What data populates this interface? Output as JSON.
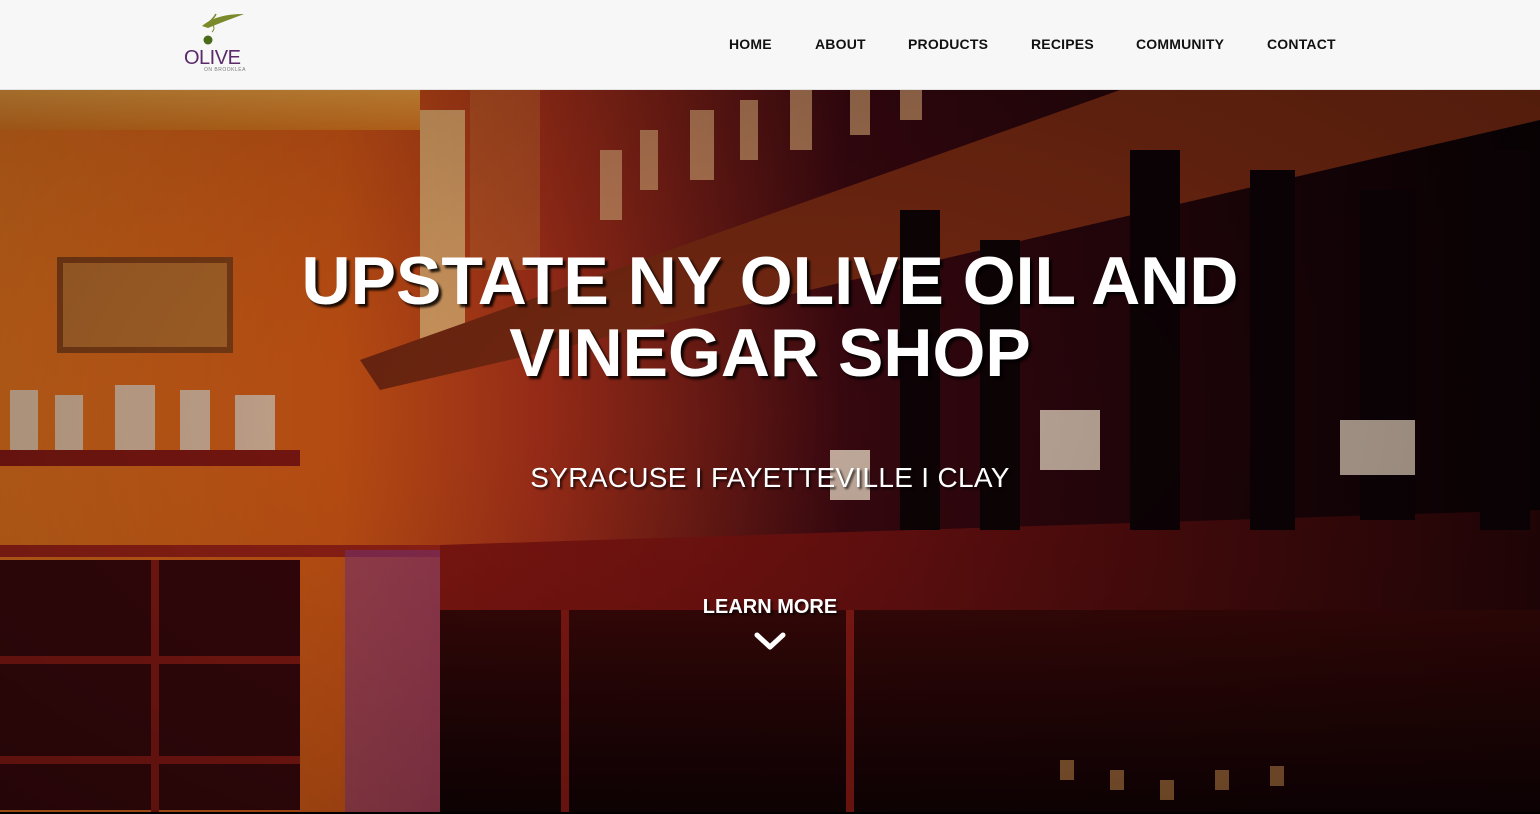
{
  "brand": {
    "logo_word": "OLIVE",
    "logo_sub": "ON BROOKLEA",
    "logo_color": "#5a2a6a",
    "leaf_color": "#7a8a2a"
  },
  "nav": {
    "items": [
      {
        "label": "HOME"
      },
      {
        "label": "ABOUT"
      },
      {
        "label": "PRODUCTS"
      },
      {
        "label": "RECIPES"
      },
      {
        "label": "COMMUNITY"
      },
      {
        "label": "CONTACT"
      }
    ]
  },
  "hero": {
    "title_line1": "UPSTATE NY OLIVE OIL AND",
    "title_line2": "VINEGAR SHOP",
    "subtitle": "SYRACUSE I FAYETTEVILLE I CLAY",
    "cta_label": "LEARN MORE",
    "cta_icon": "chevron-down-icon"
  }
}
